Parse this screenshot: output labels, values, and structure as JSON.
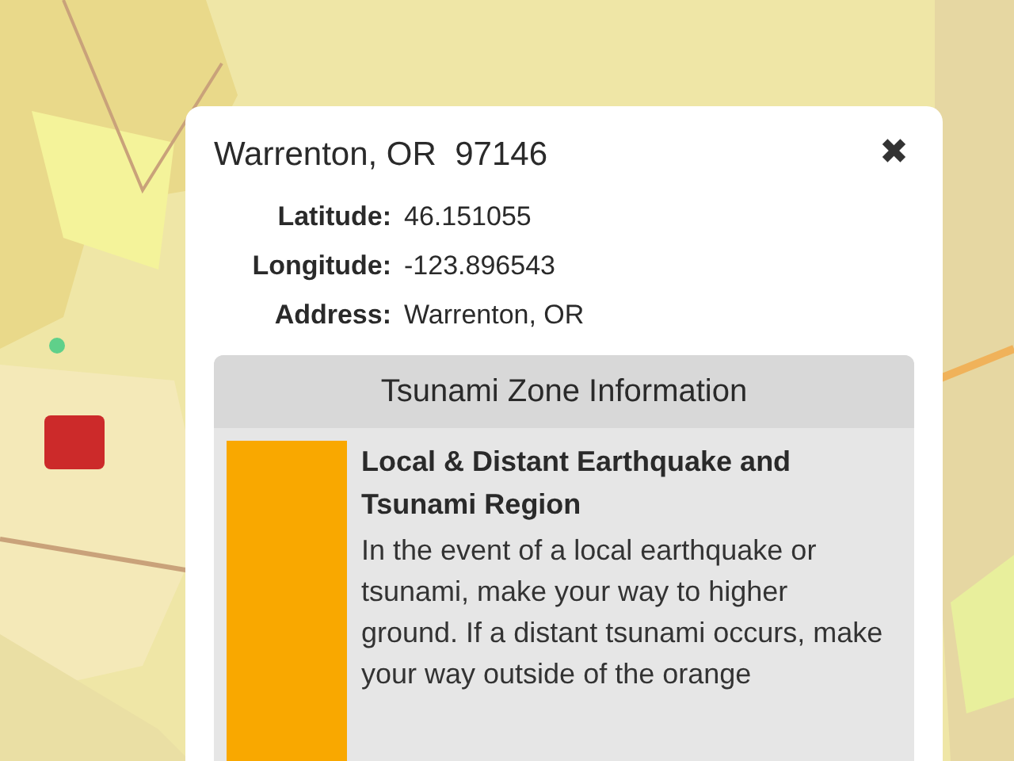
{
  "popup": {
    "title": "Warrenton, OR  97146",
    "close": "✖",
    "fields": [
      {
        "label": "Latitude:",
        "value": "46.151055"
      },
      {
        "label": "Longitude:",
        "value": "-123.896543"
      },
      {
        "label": "Address:",
        "value": "Warrenton, OR"
      }
    ],
    "section": {
      "title": "Tsunami Zone Information",
      "zones": [
        {
          "color": "#f9a800",
          "name": "Local & Distant Earthquake and Tsunami Region",
          "description": "In the event of a local earthquake or tsunami, make your way to higher ground. If a distant tsunami occurs, make your way outside of the orange"
        }
      ]
    }
  }
}
